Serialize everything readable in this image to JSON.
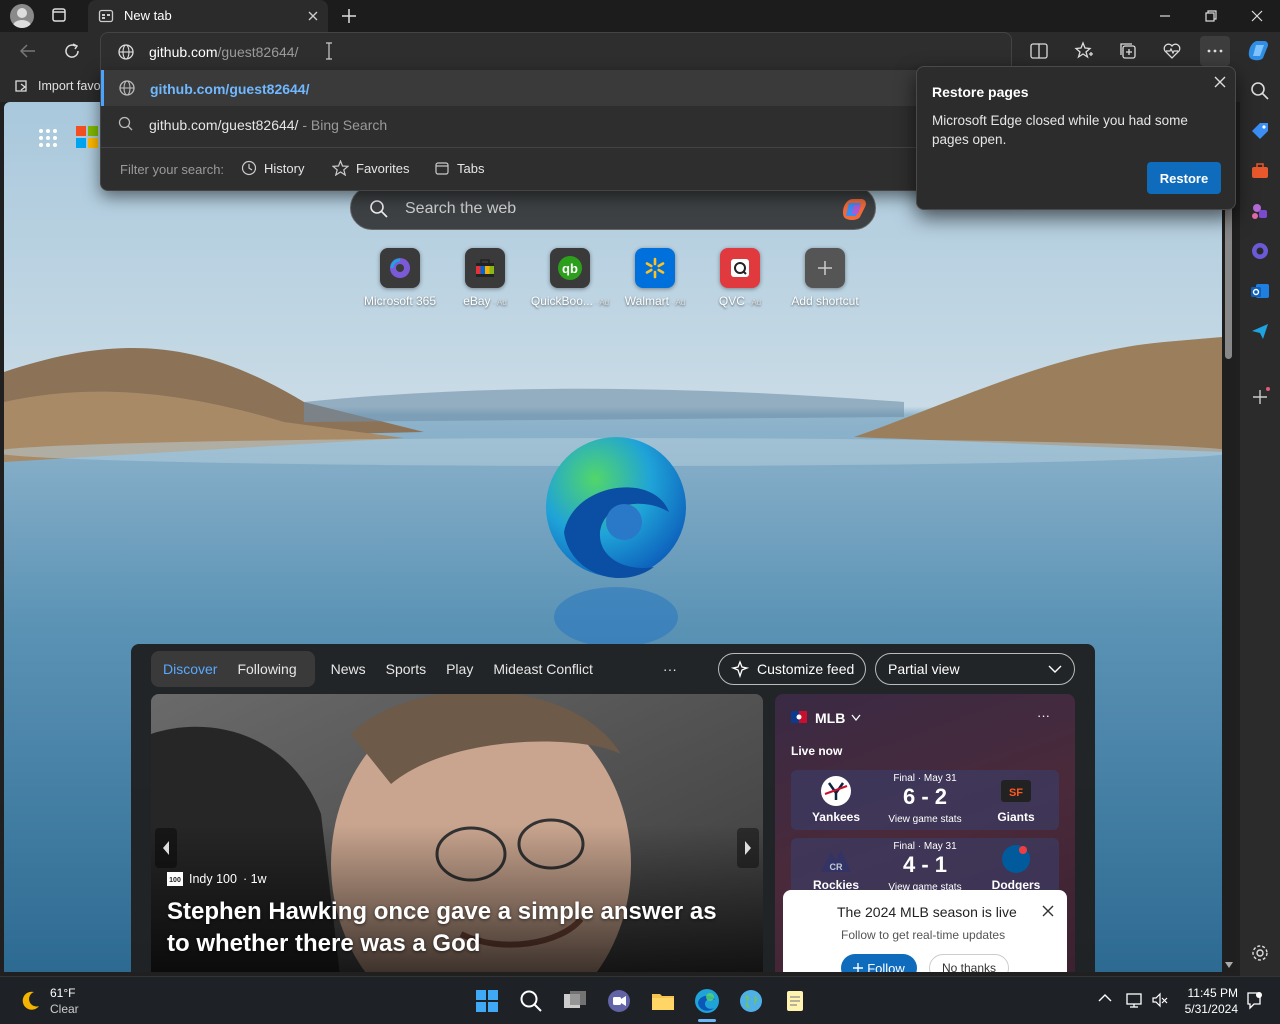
{
  "browser": {
    "tab_title": "New tab",
    "address": {
      "host": "github.com",
      "path": "/guest82644/"
    },
    "favorites_bar": {
      "import_label": "Import favo"
    }
  },
  "dropdown": {
    "suggestion_1": "github.com/guest82644/",
    "suggestion_2": "github.com/guest82644/",
    "suggestion_2_suffix": " - Bing Search",
    "filter_label": "Filter your search:",
    "filters": [
      "History",
      "Favorites",
      "Tabs"
    ]
  },
  "restore_popup": {
    "title": "Restore pages",
    "body": "Microsoft Edge closed while you had some pages open.",
    "button": "Restore"
  },
  "new_tab_page": {
    "search_placeholder": "Search the web",
    "shortcuts": [
      {
        "label": "Microsoft 365",
        "ad": ""
      },
      {
        "label": "eBay",
        "ad": "· Ad"
      },
      {
        "label": "QuickBoo...",
        "ad": "· Ad"
      },
      {
        "label": "Walmart",
        "ad": "· Ad"
      },
      {
        "label": "QVC",
        "ad": "· Ad"
      },
      {
        "label": "Add shortcut",
        "ad": ""
      }
    ]
  },
  "feed": {
    "tabs": [
      "Discover",
      "Following",
      "News",
      "Sports",
      "Play",
      "Mideast Conflict"
    ],
    "more": "···",
    "customize": "Customize feed",
    "view": "Partial view",
    "hero": {
      "source": "Indy 100",
      "age": "· 1w",
      "title": "Stephen Hawking once gave a simple answer as to whether there was a God"
    },
    "mlb": {
      "title": "MLB",
      "live": "Live now",
      "games": [
        {
          "status": "Final · May 31",
          "score": "6 - 2",
          "stats": "View game stats",
          "home": "Yankees",
          "away": "Giants"
        },
        {
          "status": "Final · May 31",
          "score": "4 - 1",
          "stats": "View game stats",
          "home": "Rockies",
          "away": "Dodgers"
        }
      ],
      "promo_title": "The 2024 MLB season is live",
      "promo_sub": "Follow to get real-time updates",
      "follow": "Follow",
      "no_thanks": "No thanks"
    }
  },
  "taskbar": {
    "weather_temp": "61°F",
    "weather_desc": "Clear",
    "time": "11:45 PM",
    "date": "5/31/2024"
  },
  "colors": {
    "accent": "#0f6cbd",
    "link": "#70b8ff"
  }
}
